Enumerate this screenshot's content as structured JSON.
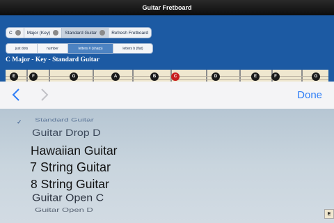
{
  "app": {
    "title": "Guitar Fretboard"
  },
  "controls": {
    "key_label": "C",
    "scale_label": "Major (Key)",
    "tuning_label": "Standard Guitar",
    "refresh_label": "Refresh Fretboard"
  },
  "display_modes": [
    "just dots",
    "number",
    "letters # (sharp)",
    "letters b (flat)"
  ],
  "selected_display_mode": "letters # (sharp)",
  "fretboard_title": "C Major - Key - Standard Guitar",
  "fretboard_notes": [
    {
      "note": "E",
      "highlight": false
    },
    {
      "note": "F",
      "highlight": false
    },
    {
      "note": "G",
      "highlight": false
    },
    {
      "note": "A",
      "highlight": false
    },
    {
      "note": "B",
      "highlight": false
    },
    {
      "note": "C",
      "highlight": true
    },
    {
      "note": "D",
      "highlight": false
    },
    {
      "note": "E",
      "highlight": false
    },
    {
      "note": "F",
      "highlight": false
    },
    {
      "note": "G",
      "highlight": false
    }
  ],
  "toolbar": {
    "done_label": "Done",
    "check_mark": "✓"
  },
  "picker": {
    "selected": "Standard Guitar",
    "options": [
      "Standard Guitar",
      "Guitar Drop D",
      "Hawaiian Guitar",
      "7 String Guitar",
      "8 String Guitar",
      "Guitar Open C",
      "Guitar Open D"
    ]
  },
  "corner_badge": "E",
  "colors": {
    "accent": "#2d7df6",
    "highlight_note": "#c81d1d",
    "header_blue": "#1c5aa3"
  }
}
